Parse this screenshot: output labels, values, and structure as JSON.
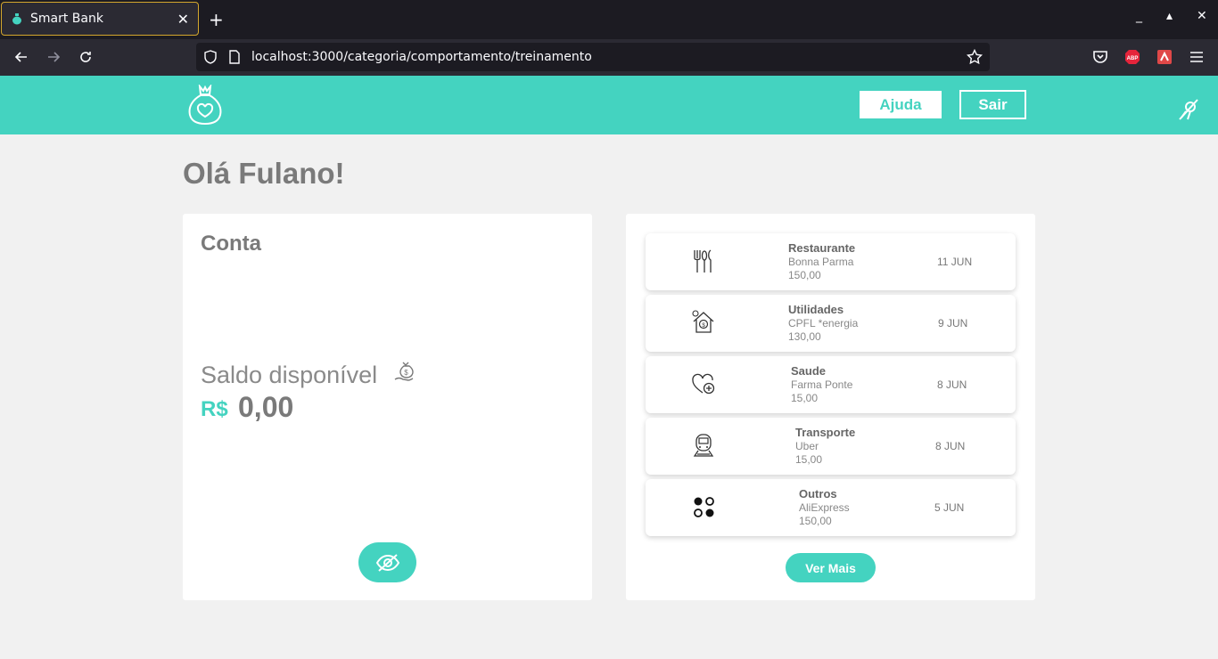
{
  "browser": {
    "tab_title": "Smart Bank",
    "tab_close": "✕",
    "new_tab": "+",
    "url": "localhost:3000/categoria/comportamento/treinamento",
    "window_controls": [
      "_",
      "▴",
      "✕"
    ]
  },
  "header": {
    "ajuda_label": "Ajuda",
    "sair_label": "Sair"
  },
  "greeting": "Olá Fulano!",
  "account": {
    "title": "Conta",
    "balance_label": "Saldo disponível",
    "currency": "R$",
    "amount": "0,00"
  },
  "transactions": [
    {
      "category": "Restaurante",
      "description": "Bonna Parma",
      "value": "150,00",
      "date": "11 JUN",
      "icon": "cutlery-icon"
    },
    {
      "category": "Utilidades",
      "description": "CPFL *energia",
      "value": "130,00",
      "date": "9 JUN",
      "icon": "house-money-icon"
    },
    {
      "category": "Saude",
      "description": "Farma Ponte",
      "value": "15,00",
      "date": "8 JUN",
      "icon": "health-heart-icon"
    },
    {
      "category": "Transporte",
      "description": "Uber",
      "value": "15,00",
      "date": "8 JUN",
      "icon": "train-icon"
    },
    {
      "category": "Outros",
      "description": "AliExpress",
      "value": "150,00",
      "date": "5 JUN",
      "icon": "dots-icon"
    }
  ],
  "ver_mais_label": "Ver Mais",
  "colors": {
    "accent": "#44d3c0",
    "text_gray": "#7a7a7a",
    "background": "#f1f1f1"
  }
}
